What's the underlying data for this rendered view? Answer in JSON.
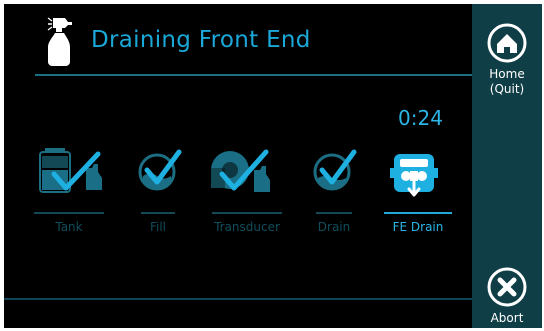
{
  "header": {
    "title": "Draining Front End",
    "icon": "spray-bottle-icon"
  },
  "timer": "0:24",
  "steps": [
    {
      "label": "Tank",
      "icon": "tank-check-icon",
      "state": "done"
    },
    {
      "label": "Fill",
      "icon": "fill-check-icon",
      "state": "done"
    },
    {
      "label": "Transducer",
      "icon": "transducer-check-icon",
      "state": "done"
    },
    {
      "label": "Drain",
      "icon": "drain-check-icon",
      "state": "done"
    },
    {
      "label": "FE Drain",
      "icon": "fe-drain-icon",
      "state": "active"
    }
  ],
  "sidebar": {
    "home_label": "Home\n(Quit)",
    "abort_label": "Abort"
  },
  "colors": {
    "accent": "#1aa8d8",
    "dim": "#114d5b",
    "sidebar_bg": "#0f3e46",
    "display_bg": "#000000"
  }
}
